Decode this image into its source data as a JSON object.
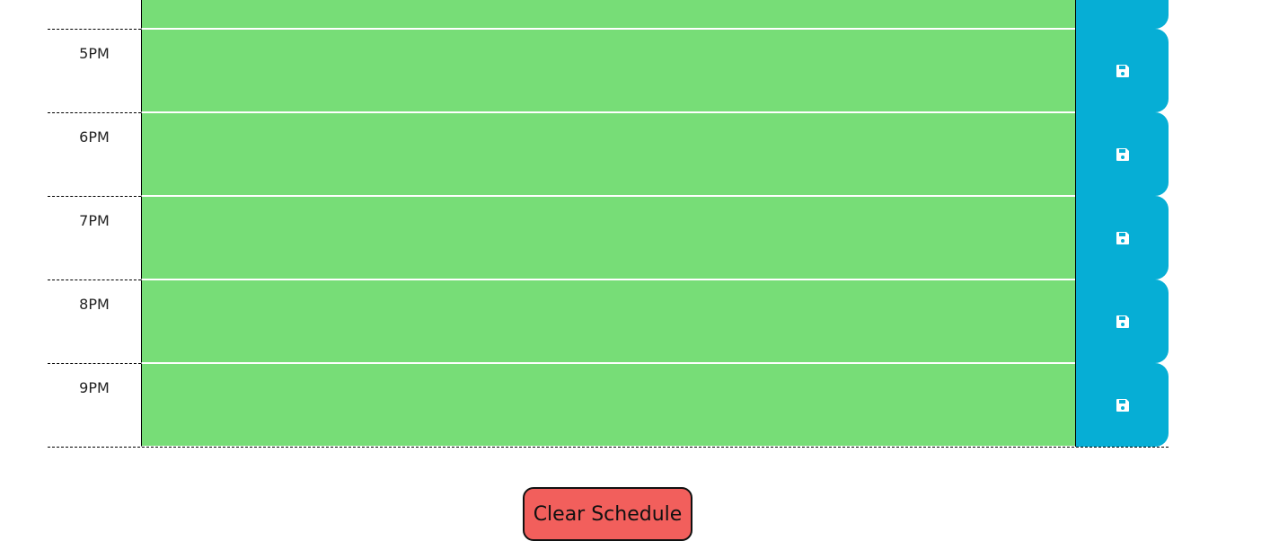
{
  "schedule": {
    "rows": [
      {
        "hour": "",
        "event_text": "",
        "save_icon": "floppy-disk-icon",
        "status": "future"
      },
      {
        "hour": "5PM",
        "event_text": "",
        "save_icon": "floppy-disk-icon",
        "status": "future"
      },
      {
        "hour": "6PM",
        "event_text": "",
        "save_icon": "floppy-disk-icon",
        "status": "future"
      },
      {
        "hour": "7PM",
        "event_text": "",
        "save_icon": "floppy-disk-icon",
        "status": "future"
      },
      {
        "hour": "8PM",
        "event_text": "",
        "save_icon": "floppy-disk-icon",
        "status": "future"
      },
      {
        "hour": "9PM",
        "event_text": "",
        "save_icon": "floppy-disk-icon",
        "status": "future"
      }
    ]
  },
  "clear_button": {
    "label": "Clear Schedule"
  },
  "colors": {
    "future": "#77dd77",
    "save_button": "#06aed5",
    "clear_button": "#f25f5c"
  }
}
